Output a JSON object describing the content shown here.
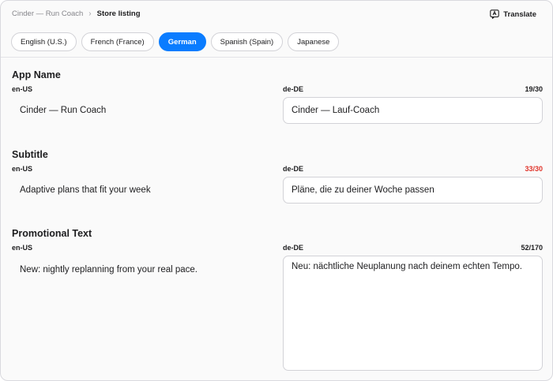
{
  "breadcrumb": {
    "app": "Cinder — Run Coach",
    "current": "Store listing"
  },
  "toolbar": {
    "translate_label": "Translate",
    "translate_icon": "translate-icon"
  },
  "tabs": [
    {
      "label": "English (U.S.)",
      "active": false
    },
    {
      "label": "French (France)",
      "active": false
    },
    {
      "label": "German",
      "active": true
    },
    {
      "label": "Spanish (Spain)",
      "active": false
    },
    {
      "label": "Japanese",
      "active": false
    }
  ],
  "sections": {
    "app_name": {
      "title": "App Name",
      "source_locale": "en-US",
      "target_locale": "de-DE",
      "counter": "19/30",
      "source_text": "Cinder — Run Coach",
      "target_value": "Cinder — Lauf-Coach"
    },
    "subtitle": {
      "title": "Subtitle",
      "source_locale": "en-US",
      "target_locale": "de-DE",
      "counter": "33/30",
      "source_text": "Adaptive plans that fit your week",
      "target_value": "Pläne, die zu deiner Woche passen"
    },
    "promo": {
      "title": "Promotional Text",
      "source_locale": "en-US",
      "target_locale": "de-DE",
      "counter": "52/170",
      "source_text": "New: nightly replanning from your real pace.",
      "target_value": "Neu: nächtliche Neuplanung nach deinem echten Tempo."
    }
  },
  "colors": {
    "accent": "#0a7cff",
    "over_limit": "#e0362c"
  }
}
